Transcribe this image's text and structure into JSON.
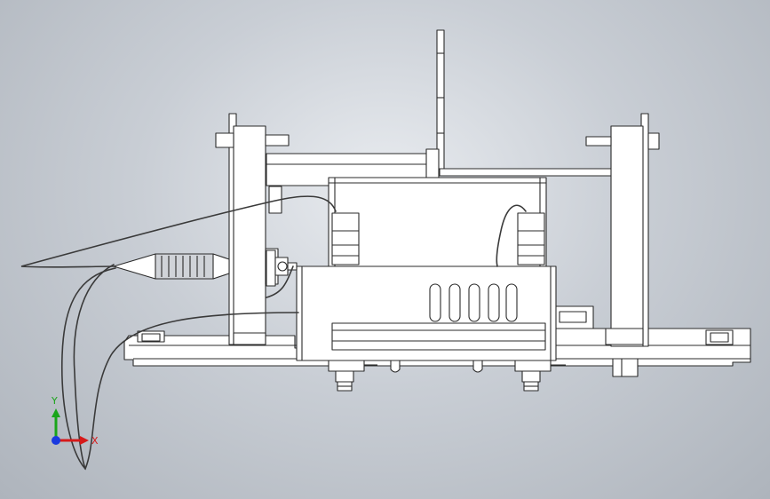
{
  "triad": {
    "x_label": "X",
    "y_label": "Y",
    "x_color": "#d61a1a",
    "y_color": "#1aa51a",
    "z_color": "#1a3adf"
  },
  "viewport": {
    "background_center": "#e9ecf0",
    "background_edge": "#aeb4bc"
  },
  "model": {
    "part_fill": "#ffffff",
    "edge_color": "#2b2b2b",
    "cable_color": "#3a3a3a",
    "shade_fill": "#d0d3d8"
  }
}
